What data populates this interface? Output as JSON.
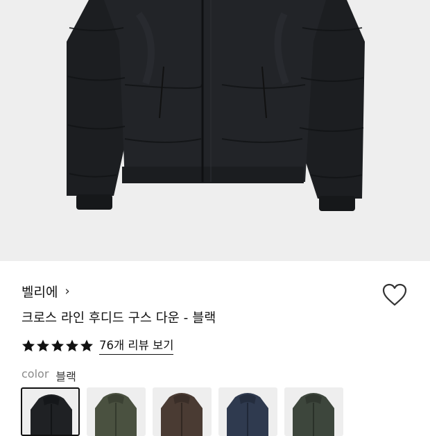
{
  "product": {
    "brand": "벨리에",
    "brand_chevron": "›",
    "title": "크로스 라인 후디드 구스 다운 - 블랙",
    "rating_stars": 5,
    "review_link": "76개 리뷰 보기"
  },
  "color": {
    "label": "color",
    "selected_value": "블랙",
    "swatches": [
      {
        "name": "black",
        "hex": "#1f2124"
      },
      {
        "name": "olive",
        "hex": "#4a5140"
      },
      {
        "name": "brown",
        "hex": "#4a3b33"
      },
      {
        "name": "navy",
        "hex": "#2f3a4f"
      },
      {
        "name": "dark-green",
        "hex": "#3d463c"
      }
    ]
  },
  "icons": {
    "wishlist": "heart-icon",
    "star": "star-icon"
  }
}
